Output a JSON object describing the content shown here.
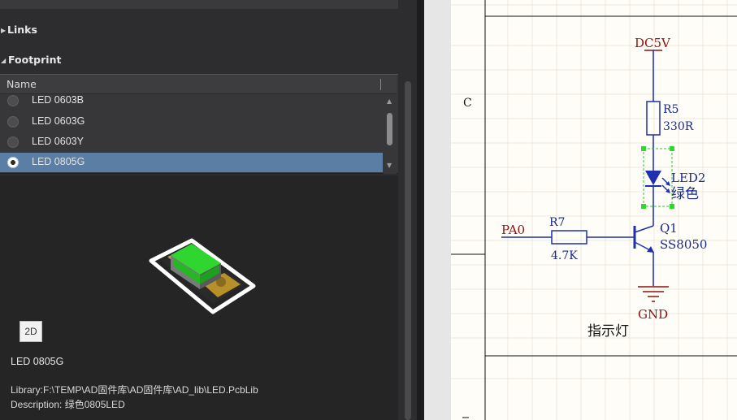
{
  "properties_panel": {
    "links_label": "Links",
    "footprint_label": "Footprint",
    "list": {
      "column_name": "Name",
      "rows": [
        {
          "name": "LED 0603B",
          "selected": false
        },
        {
          "name": "LED 0603G",
          "selected": false
        },
        {
          "name": "LED 0603Y",
          "selected": false
        },
        {
          "name": "LED 0805G",
          "selected": true
        }
      ]
    },
    "preview": {
      "view_toggle_label": "2D",
      "component_name": "LED 0805G",
      "library_line": "Library:F:\\TEMP\\AD固件库\\AD固件库\\AD_lib\\LED.PcbLib",
      "description_line": "Description: 绿色0805LED"
    }
  },
  "schematic": {
    "zone_label": "C",
    "power_net": "DC5V",
    "resistor_r5": {
      "designator": "R5",
      "value": "330R"
    },
    "led2": {
      "designator": "LED2",
      "comment": "绿色"
    },
    "resistor_r7": {
      "designator": "R7",
      "value": "4.7K"
    },
    "transistor_q1": {
      "designator": "Q1",
      "value": "SS8050"
    },
    "input_net": "PA0",
    "ground_net": "GND",
    "block_title": "指示灯"
  },
  "colors": {
    "selection": "#5b7fa4",
    "wire": "#1f2fb0",
    "power_label": "#8b1010",
    "component_text": "#1a2a8a",
    "led_green": "#33dd33",
    "pad_gold": "#c8a028"
  },
  "icons": [
    "collapse-triangle-icon",
    "expand-triangle-icon",
    "radio-icon",
    "scroll-up-icon",
    "scroll-down-icon"
  ]
}
